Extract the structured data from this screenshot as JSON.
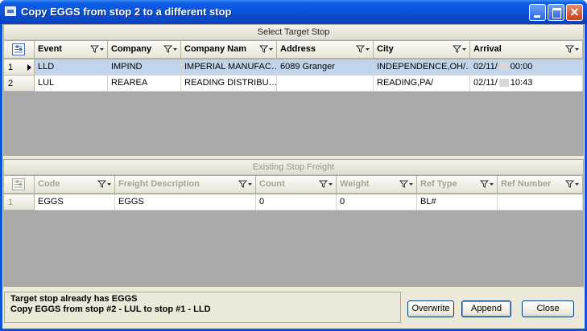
{
  "window": {
    "title": "Copy EGGS from stop 2 to a different stop",
    "minimize_label": "",
    "maximize_label": "",
    "close_label": "✕"
  },
  "target_grid": {
    "caption": "Select Target Stop",
    "columns": [
      "Event",
      "Company",
      "Company Nam",
      "Address",
      "City",
      "Arrival"
    ],
    "rows": [
      {
        "num": "1",
        "event": "LLD",
        "company": "IMPIND",
        "company_name": "IMPERIAL MANUFAC…",
        "address": "6089 Granger",
        "city": "INDEPENDENCE,OH/…",
        "arrival_date": "02/11/",
        "arrival_time": "00:00",
        "selected": true
      },
      {
        "num": "2",
        "event": "LUL",
        "company": "REAREA",
        "company_name": "READING DISTRIBU…",
        "address": "",
        "city": "READING,PA/",
        "arrival_date": "02/11/",
        "arrival_time": "10:43",
        "selected": false
      }
    ]
  },
  "freight_grid": {
    "caption": "Existing Stop Freight",
    "columns": [
      "Code",
      "Freight Description",
      "Count",
      "Weight",
      "Ref Type",
      "Ref Number"
    ],
    "rows": [
      {
        "num": "1",
        "code": "EGGS",
        "description": "EGGS",
        "count": "0",
        "weight": "0",
        "ref_type": "BL#",
        "ref_number": ""
      }
    ]
  },
  "message": {
    "line1": "Target stop already has EGGS",
    "line2": "Copy EGGS from stop #2 - LUL to stop #1 - LLD"
  },
  "buttons": {
    "overwrite": "Overwrite",
    "append": "Append",
    "close": "Close"
  }
}
